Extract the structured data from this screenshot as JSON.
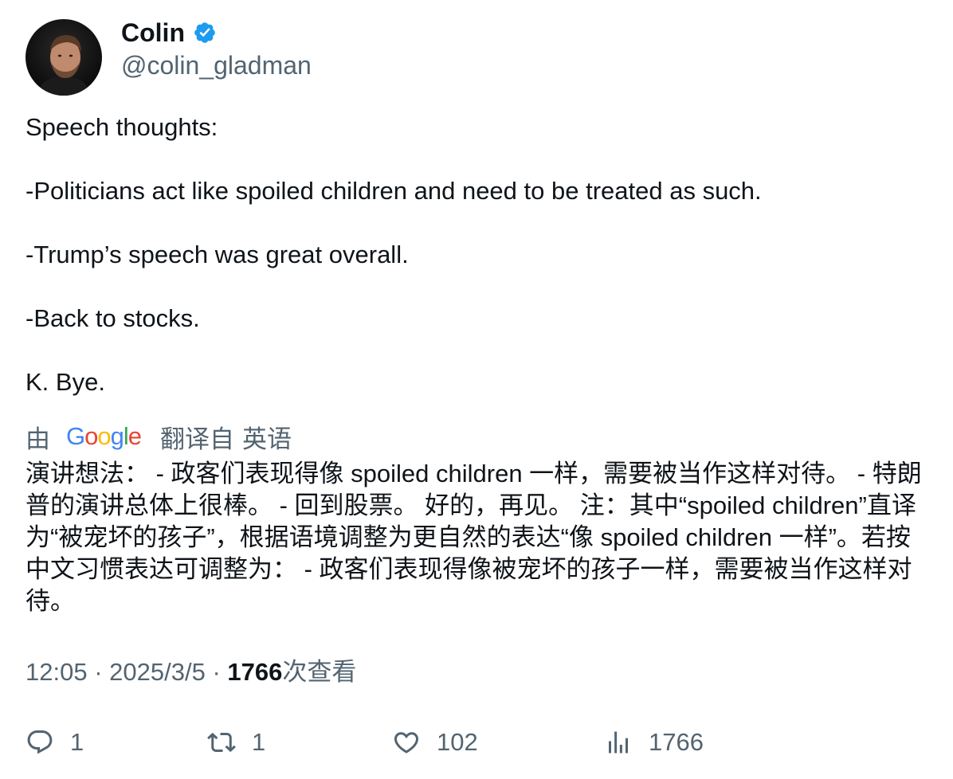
{
  "author": {
    "display_name": "Colin",
    "handle": "@colin_gladman",
    "verified": true,
    "avatar_icon": "profile-photo"
  },
  "tweet": {
    "lines": [
      "Speech thoughts:",
      "-Politicians act like spoiled children and need to be treated as such.",
      "-Trump’s speech was great overall.",
      "-Back to stocks.",
      "K. Bye."
    ]
  },
  "translation": {
    "prefix": "由",
    "provider": "Google",
    "suffix": "翻译自",
    "language": "英语",
    "text": "演讲想法： - 政客们表现得像 spoiled children 一样，需要被当作这样对待。 - 特朗普的演讲总体上很棒。 - 回到股票。 好的，再见。 注：其中“spoiled children”直译为“被宠坏的孩子”，根据语境调整为更自然的表达“像 spoiled children 一样”。若按中文习惯表达可调整为： - 政客们表现得像被宠坏的孩子一样，需要被当作这样对待。"
  },
  "meta": {
    "time": "12:05",
    "separator": "·",
    "date": "2025/3/5",
    "views": "1766",
    "views_label": "次查看"
  },
  "actions": {
    "replies": "1",
    "retweets": "1",
    "likes": "102",
    "views": "1766"
  },
  "colors": {
    "text_primary": "#0f1419",
    "text_secondary": "#536471",
    "verified_blue": "#1d9bf0"
  }
}
